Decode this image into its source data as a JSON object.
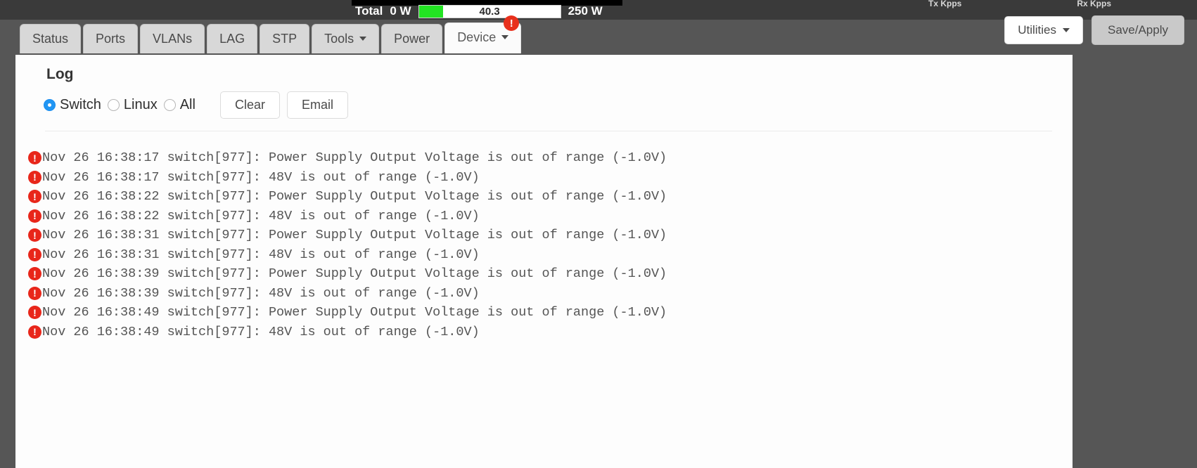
{
  "header": {
    "power": {
      "label": "Total",
      "min": "0 W",
      "value": "40.3",
      "max": "250 W",
      "fill_percent": 17,
      "fill_color": "#22e322"
    },
    "kpps": {
      "tx": "Tx Kpps",
      "rx": "Rx Kpps"
    },
    "utilities_label": "Utilities",
    "save_apply_label": "Save/Apply"
  },
  "tabs": [
    {
      "label": "Status",
      "active": false,
      "caret": false,
      "badge": ""
    },
    {
      "label": "Ports",
      "active": false,
      "caret": false,
      "badge": ""
    },
    {
      "label": "VLANs",
      "active": false,
      "caret": false,
      "badge": ""
    },
    {
      "label": "LAG",
      "active": false,
      "caret": false,
      "badge": ""
    },
    {
      "label": "STP",
      "active": false,
      "caret": false,
      "badge": ""
    },
    {
      "label": "Tools",
      "active": false,
      "caret": true,
      "badge": ""
    },
    {
      "label": "Power",
      "active": false,
      "caret": false,
      "badge": ""
    },
    {
      "label": "Device",
      "active": true,
      "caret": true,
      "badge": "!"
    }
  ],
  "panel": {
    "title": "Log",
    "radios": [
      {
        "label": "Switch",
        "selected": true
      },
      {
        "label": "Linux",
        "selected": false
      },
      {
        "label": "All",
        "selected": false
      }
    ],
    "buttons": [
      {
        "label": "Clear"
      },
      {
        "label": "Email"
      }
    ],
    "accent_color": "#2196f3",
    "error_color": "#e8261a"
  },
  "log": {
    "entries": [
      {
        "icon": "!",
        "text": "Nov 26 16:38:17 switch[977]: Power Supply Output Voltage is out of range (-1.0V)"
      },
      {
        "icon": "!",
        "text": "Nov 26 16:38:17 switch[977]: 48V is out of range (-1.0V)"
      },
      {
        "icon": "!",
        "text": "Nov 26 16:38:22 switch[977]: Power Supply Output Voltage is out of range (-1.0V)"
      },
      {
        "icon": "!",
        "text": "Nov 26 16:38:22 switch[977]: 48V is out of range (-1.0V)"
      },
      {
        "icon": "!",
        "text": "Nov 26 16:38:31 switch[977]: Power Supply Output Voltage is out of range (-1.0V)"
      },
      {
        "icon": "!",
        "text": "Nov 26 16:38:31 switch[977]: 48V is out of range (-1.0V)"
      },
      {
        "icon": "!",
        "text": "Nov 26 16:38:39 switch[977]: Power Supply Output Voltage is out of range (-1.0V)"
      },
      {
        "icon": "!",
        "text": "Nov 26 16:38:39 switch[977]: 48V is out of range (-1.0V)"
      },
      {
        "icon": "!",
        "text": "Nov 26 16:38:49 switch[977]: Power Supply Output Voltage is out of range (-1.0V)"
      },
      {
        "icon": "!",
        "text": "Nov 26 16:38:49 switch[977]: 48V is out of range (-1.0V)"
      }
    ]
  }
}
